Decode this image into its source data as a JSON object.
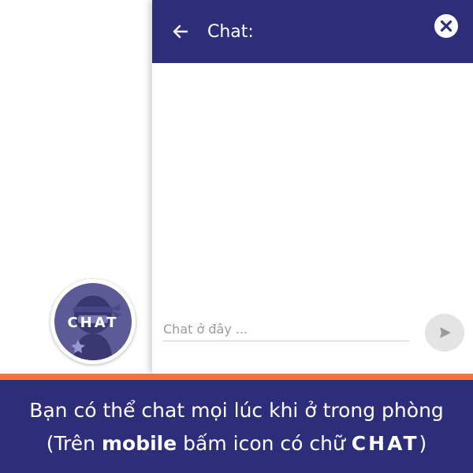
{
  "chat": {
    "title": "Chat:",
    "input_placeholder": "Chat ở đây ...",
    "back_icon": "arrow-left-icon",
    "close_icon": "close-icon",
    "send_icon": "send-icon"
  },
  "fab": {
    "label": "CHAT",
    "icon": "ninja-avatar"
  },
  "caption": {
    "line1": "Bạn có thể chat mọi lúc khi ở trong phòng",
    "line2_open": "(Trên",
    "line2_bold1": "mobile",
    "line2_mid": "bấm icon có chữ",
    "line2_bold2": "CHAT",
    "line2_close": ")"
  },
  "colors": {
    "header": "#2e2d7a",
    "accent_strip": "#f0773a",
    "caption_bg": "#2e2d7a",
    "fab_bg": "#5d5a98"
  }
}
